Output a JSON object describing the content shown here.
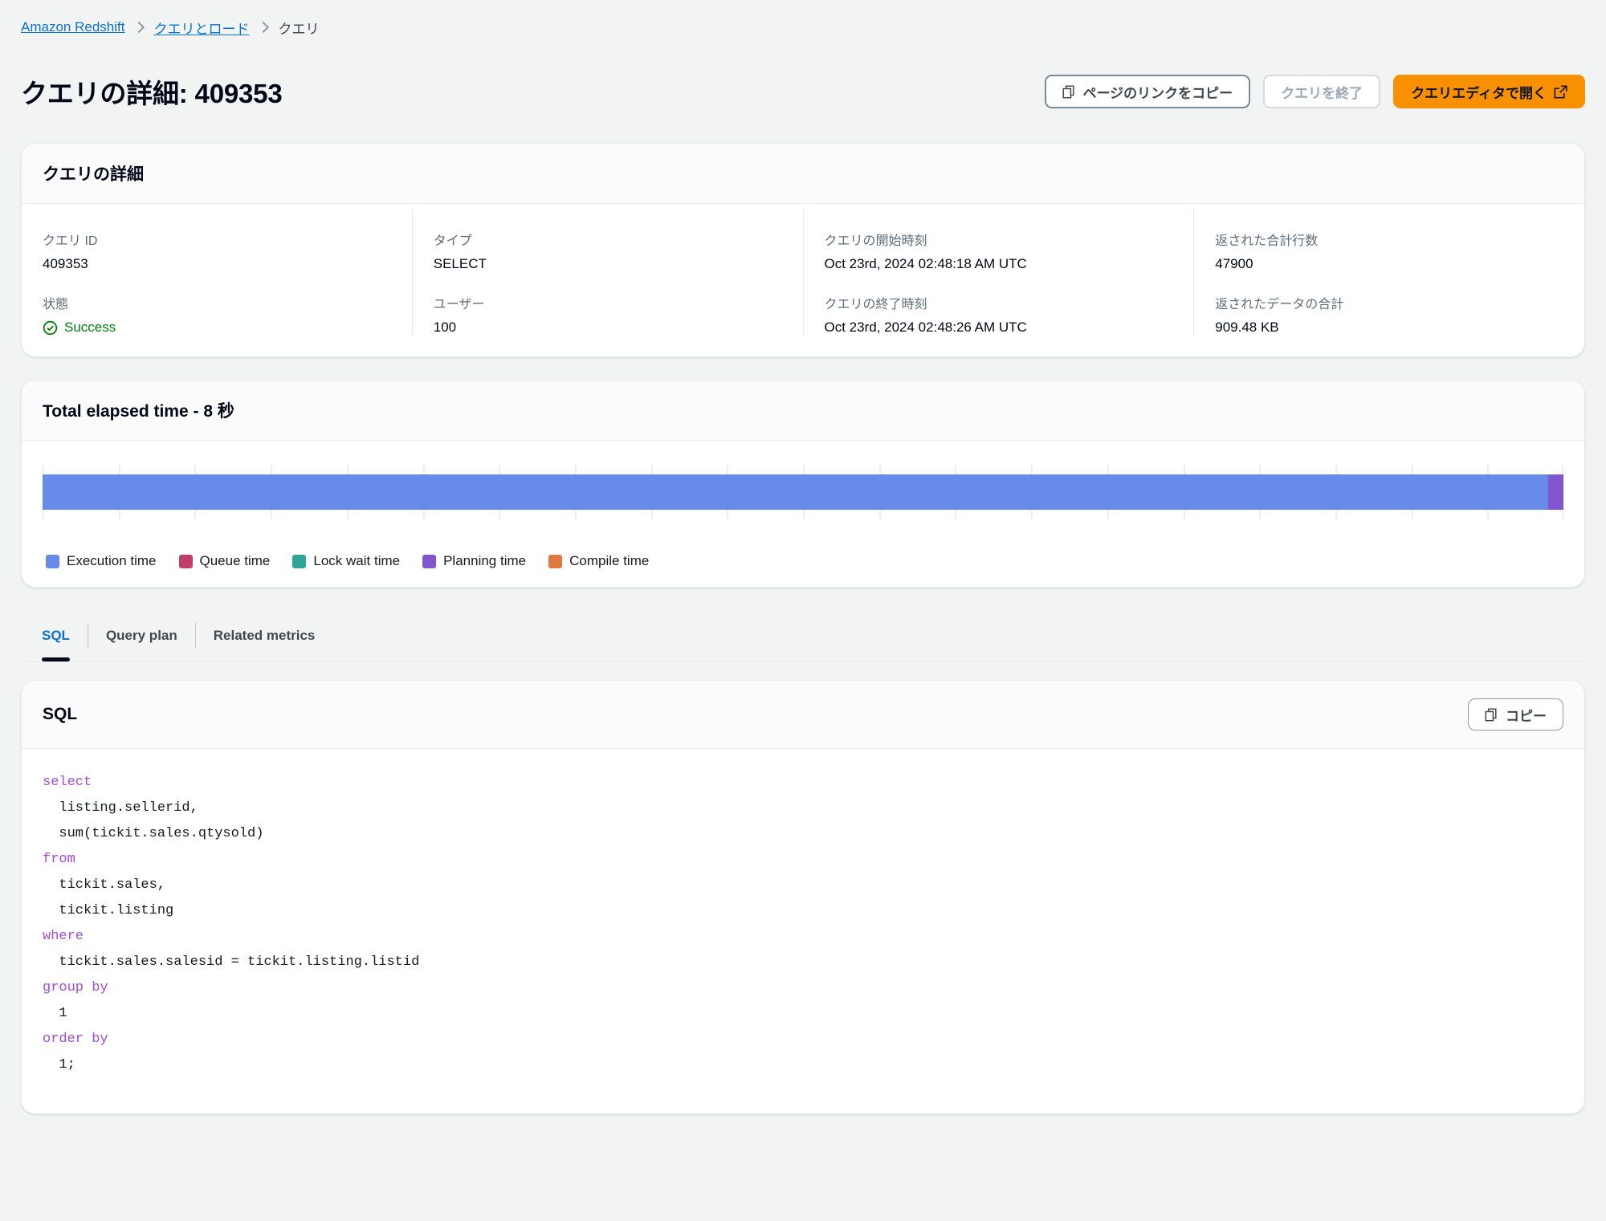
{
  "breadcrumb": {
    "items": [
      {
        "label": "Amazon Redshift",
        "link": true
      },
      {
        "label": "クエリとロード",
        "link": true
      },
      {
        "label": "クエリ",
        "link": false
      }
    ]
  },
  "header": {
    "title": "クエリの詳細: 409353",
    "copy_link_label": "ページのリンクをコピー",
    "terminate_label": "クエリを終了",
    "open_editor_label": "クエリエディタで開く"
  },
  "details": {
    "card_title": "クエリの詳細",
    "columns": [
      {
        "items": [
          {
            "label": "クエリ ID",
            "value": "409353"
          },
          {
            "label": "状態",
            "value": "Success",
            "status": "success"
          }
        ]
      },
      {
        "items": [
          {
            "label": "タイプ",
            "value": "SELECT"
          },
          {
            "label": "ユーザー",
            "value": "100"
          }
        ]
      },
      {
        "items": [
          {
            "label": "クエリの開始時刻",
            "value": "Oct 23rd, 2024 02:48:18 AM UTC"
          },
          {
            "label": "クエリの終了時刻",
            "value": "Oct 23rd, 2024 02:48:26 AM UTC"
          }
        ]
      },
      {
        "items": [
          {
            "label": "返された合計行数",
            "value": "47900"
          },
          {
            "label": "返されたデータの合計",
            "value": "909.48 KB"
          }
        ]
      }
    ]
  },
  "chart_data": {
    "type": "bar",
    "orientation": "horizontal",
    "stacked": true,
    "title": "Total elapsed time - 8 秒",
    "total_elapsed_seconds": 8,
    "categories": [
      "Total elapsed time"
    ],
    "xlabel": "",
    "ylabel": "",
    "grid": true,
    "gridline_count": 21,
    "legend_position": "bottom",
    "series": [
      {
        "name": "Execution time",
        "color": "#688ae8",
        "values": [
          7.92
        ],
        "percent": 99.0
      },
      {
        "name": "Queue time",
        "color": "#c33d69",
        "values": [
          0
        ],
        "percent": 0
      },
      {
        "name": "Lock wait time",
        "color": "#2ea597",
        "values": [
          0
        ],
        "percent": 0
      },
      {
        "name": "Planning time",
        "color": "#8456ce",
        "values": [
          0.08
        ],
        "percent": 1.0
      },
      {
        "name": "Compile time",
        "color": "#e07941",
        "values": [
          0
        ],
        "percent": 0
      }
    ]
  },
  "tabs": [
    {
      "label": "SQL",
      "active": true
    },
    {
      "label": "Query plan",
      "active": false
    },
    {
      "label": "Related metrics",
      "active": false
    }
  ],
  "sql_panel": {
    "title": "SQL",
    "copy_label": "コピー",
    "lines": [
      {
        "keyword": "select",
        "rest": ""
      },
      {
        "keyword": "",
        "rest": "  listing.sellerid,"
      },
      {
        "keyword": "",
        "rest": "  sum(tickit.sales.qtysold)"
      },
      {
        "keyword": "from",
        "rest": ""
      },
      {
        "keyword": "",
        "rest": "  tickit.sales,"
      },
      {
        "keyword": "",
        "rest": "  tickit.listing"
      },
      {
        "keyword": "where",
        "rest": ""
      },
      {
        "keyword": "",
        "rest": "  tickit.sales.salesid = tickit.listing.listid"
      },
      {
        "keyword": "group by",
        "rest": ""
      },
      {
        "keyword": "",
        "rest": "  1"
      },
      {
        "keyword": "order by",
        "rest": ""
      },
      {
        "keyword": "",
        "rest": "  1;"
      }
    ]
  },
  "colors": {
    "accent": "#0972d3",
    "primary_button": "#f89000",
    "success": "#037f0c",
    "page_background": "#f2f3f3"
  }
}
